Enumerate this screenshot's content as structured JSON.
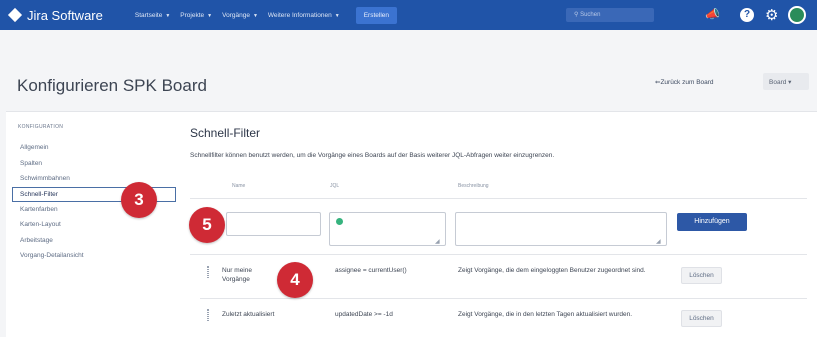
{
  "nav": {
    "brand": "Jira Software",
    "menu": [
      {
        "label": "Startseite"
      },
      {
        "label": "Projekte"
      },
      {
        "label": "Vorgänge"
      },
      {
        "label": "Weitere Informationen"
      }
    ],
    "create_label": "Erstellen",
    "search_placeholder": "Suchen",
    "icons": [
      "notifications-icon",
      "help-icon",
      "settings-icon",
      "profile-avatar"
    ],
    "accent": "#2054a8"
  },
  "page": {
    "title": "Konfigurieren SPK Board",
    "back_link": "⇐Zurück zum Board",
    "board_menu": "Board ▾"
  },
  "sidebar": {
    "heading": "KONFIGURATION",
    "items": [
      {
        "label": "Allgemein"
      },
      {
        "label": "Spalten"
      },
      {
        "label": "Schwimmbahnen"
      },
      {
        "label": "Schnell-Filter",
        "active": true
      },
      {
        "label": "Kartenfarben"
      },
      {
        "label": "Karten-Layout"
      },
      {
        "label": "Arbeitstage"
      },
      {
        "label": "Vorgang-Detailansicht"
      }
    ]
  },
  "main": {
    "title": "Schnell-Filter",
    "description": "Schnellfilter können benutzt werden, um die Vorgänge eines Boards auf der Basis weiterer JQL-Abfragen weiter einzugrenzen.",
    "columns": {
      "name": "Name",
      "jql": "JQL",
      "description": "Beschreibung"
    },
    "add_button": "Hinzufügen",
    "filters": [
      {
        "name": "Nur meine Vorgänge",
        "jql": "assignee = currentUser()",
        "description": "Zeigt Vorgänge, die dem eingeloggten Benutzer zugeordnet sind.",
        "delete_label": "Löschen"
      },
      {
        "name": "Zuletzt aktualisiert",
        "jql": "updatedDate >= -1d",
        "description": "Zeigt Vorgänge, die in den letzten Tagen aktualisiert wurden.",
        "delete_label": "Löschen"
      }
    ]
  },
  "callouts": [
    {
      "number": "3",
      "color": "#cf2a35"
    },
    {
      "number": "5",
      "color": "#cf2a35"
    },
    {
      "number": "4",
      "color": "#cf2a35"
    }
  ]
}
